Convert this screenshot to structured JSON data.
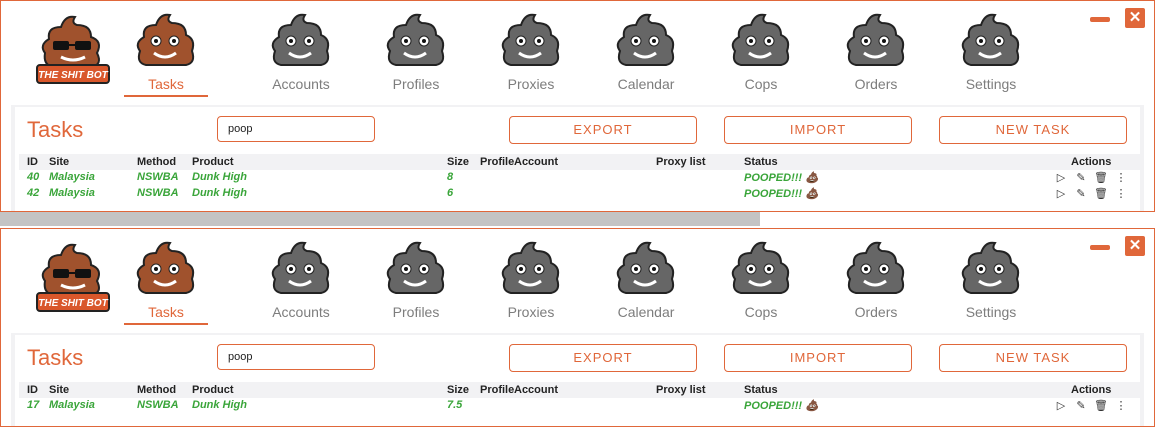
{
  "app": {
    "logo_text": "THE SHIT BOT",
    "nav": [
      {
        "label": "Tasks",
        "icon": "poop-tasks-icon",
        "active": true
      },
      {
        "label": "Accounts",
        "icon": "poop-accounts-icon",
        "active": false
      },
      {
        "label": "Profiles",
        "icon": "poop-profiles-icon",
        "active": false
      },
      {
        "label": "Proxies",
        "icon": "poop-proxies-icon",
        "active": false
      },
      {
        "label": "Calendar",
        "icon": "poop-calendar-icon",
        "active": false
      },
      {
        "label": "Cops",
        "icon": "poop-cops-icon",
        "active": false
      },
      {
        "label": "Orders",
        "icon": "poop-orders-icon",
        "active": false
      },
      {
        "label": "Settings",
        "icon": "poop-settings-icon",
        "active": false
      }
    ],
    "window_controls": {
      "minimize_icon": "minimize-icon",
      "close_label": "✕"
    },
    "accent": "#e0673a",
    "success": "#3aa53a"
  },
  "page": {
    "title": "Tasks",
    "buttons": {
      "export": "EXPORT",
      "import": "IMPORT",
      "new_task": "NEW TASK"
    },
    "columns": {
      "id": "ID",
      "site": "Site",
      "method": "Method",
      "product": "Product",
      "size": "Size",
      "profile": "Profile",
      "account": "Account",
      "proxy_list": "Proxy list",
      "status": "Status",
      "actions": "Actions"
    },
    "action_icons": [
      "play-icon",
      "edit-icon",
      "trash-icon",
      "more-icon"
    ]
  },
  "windows": [
    {
      "search_value": "poop",
      "rows": [
        {
          "id": "40",
          "site": "Malaysia",
          "method": "NSWBA",
          "product": "Dunk High",
          "size": "8",
          "profile": "",
          "account": "",
          "proxy_list": "",
          "status": "POOPED!!! 💩"
        },
        {
          "id": "42",
          "site": "Malaysia",
          "method": "NSWBA",
          "product": "Dunk High",
          "size": "6",
          "profile": "",
          "account": "",
          "proxy_list": "",
          "status": "POOPED!!! 💩"
        }
      ]
    },
    {
      "search_value": "poop",
      "rows": [
        {
          "id": "17",
          "site": "Malaysia",
          "method": "NSWBA",
          "product": "Dunk High",
          "size": "7.5",
          "profile": "",
          "account": "",
          "proxy_list": "",
          "status": "POOPED!!! 💩"
        }
      ]
    }
  ]
}
